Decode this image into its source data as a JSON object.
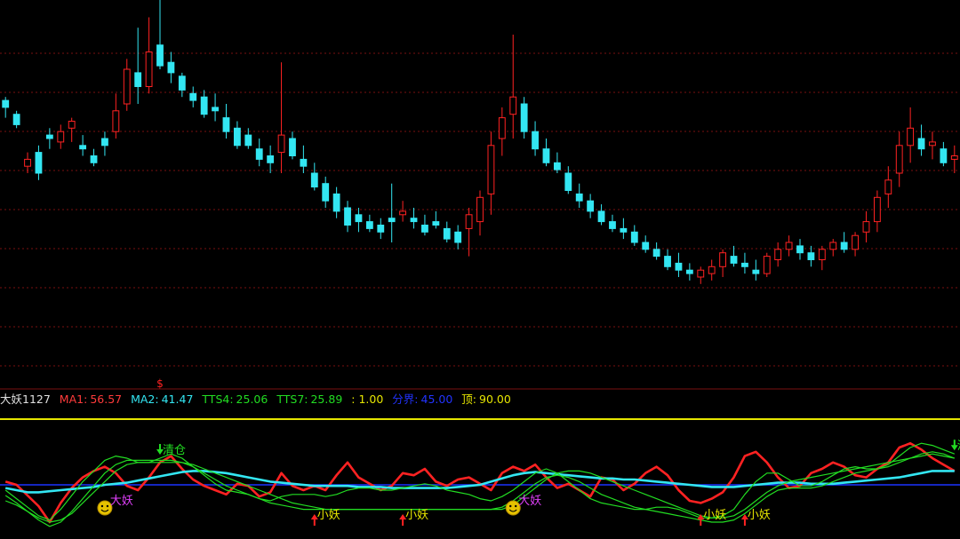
{
  "indicator_name": "大妖1127",
  "legend": [
    {
      "label": "MA1:",
      "value": "56.57",
      "color": "#ff3b3b"
    },
    {
      "label": "MA2:",
      "value": "41.47",
      "color": "#33e6f2"
    },
    {
      "label": "TTS4:",
      "value": "25.06",
      "color": "#22dd22"
    },
    {
      "label": "TTS7:",
      "value": "25.89",
      "color": "#22dd22"
    },
    {
      "label": "",
      "value": ": 1.00",
      "color": "#e6e600"
    },
    {
      "label": "分界:",
      "value": "45.00",
      "color": "#2233ff"
    },
    {
      "label": "顶:",
      "value": "90.00",
      "color": "#e6e600"
    }
  ],
  "colors": {
    "up": "#ff2222",
    "down": "#33e6f2",
    "grid": "#7a1010",
    "separator": "#e6e600",
    "divider_line": "#1a33ff"
  },
  "price_marker": "$",
  "signals": [
    {
      "kind": "big",
      "text": "大妖",
      "icon": "smiley-icon",
      "index": 9
    },
    {
      "kind": "big",
      "text": "大妖",
      "icon": "smiley-icon",
      "index": 46
    },
    {
      "kind": "small",
      "text": "小妖",
      "icon": "up-arrow-icon",
      "index": 28
    },
    {
      "kind": "small",
      "text": "小妖",
      "icon": "up-arrow-icon",
      "index": 36
    },
    {
      "kind": "small",
      "text": "小妖",
      "icon": "up-arrow-icon",
      "index": 63
    },
    {
      "kind": "small",
      "text": "小妖",
      "icon": "up-arrow-icon",
      "index": 67
    },
    {
      "kind": "clear",
      "text": "清仓",
      "icon": "down-arrow-icon",
      "index": 14
    },
    {
      "kind": "clear",
      "text": "清仓",
      "icon": "down-arrow-icon",
      "index": 86
    }
  ],
  "chart_data": [
    {
      "type": "candlestick",
      "ylim": [
        0,
        100
      ],
      "grid": true,
      "candles": [
        [
          71,
          72,
          66,
          69
        ],
        [
          67,
          68,
          63,
          64
        ],
        [
          52,
          56,
          50,
          54
        ],
        [
          56,
          58,
          48,
          50
        ],
        [
          61,
          63,
          57,
          60
        ],
        [
          59,
          64,
          57,
          62
        ],
        [
          63,
          66,
          59,
          65
        ],
        [
          58,
          61,
          55,
          57
        ],
        [
          55,
          57,
          52,
          53
        ],
        [
          60,
          62,
          55,
          58
        ],
        [
          62,
          73,
          60,
          68
        ],
        [
          70,
          83,
          68,
          80
        ],
        [
          79,
          92,
          70,
          75
        ],
        [
          75,
          95,
          73,
          85
        ],
        [
          87,
          100,
          80,
          81
        ],
        [
          82,
          85,
          76,
          79
        ],
        [
          78,
          79,
          72,
          74
        ],
        [
          73,
          75,
          69,
          71
        ],
        [
          72,
          74,
          66,
          67
        ],
        [
          69,
          73,
          65,
          68
        ],
        [
          66,
          70,
          60,
          62
        ],
        [
          63,
          65,
          57,
          58
        ],
        [
          61,
          63,
          57,
          58
        ],
        [
          57,
          60,
          52,
          54
        ],
        [
          55,
          58,
          50,
          53
        ],
        [
          56,
          82,
          50,
          61
        ],
        [
          60,
          62,
          54,
          55
        ],
        [
          54,
          58,
          50,
          52
        ],
        [
          50,
          53,
          45,
          46
        ],
        [
          47,
          49,
          40,
          42
        ],
        [
          44,
          46,
          37,
          39
        ],
        [
          40,
          42,
          33,
          35
        ],
        [
          38,
          40,
          33,
          36
        ],
        [
          36,
          38,
          33,
          34
        ],
        [
          35,
          37,
          31,
          33
        ],
        [
          37,
          47,
          30,
          36
        ],
        [
          38,
          42,
          36,
          39
        ],
        [
          37,
          40,
          34,
          36
        ],
        [
          35,
          38,
          32,
          33
        ],
        [
          36,
          39,
          34,
          35
        ],
        [
          34,
          36,
          30,
          31
        ],
        [
          33,
          35,
          28,
          30
        ],
        [
          34,
          40,
          26,
          38
        ],
        [
          36,
          45,
          32,
          43
        ],
        [
          44,
          62,
          38,
          58
        ],
        [
          60,
          69,
          55,
          66
        ],
        [
          67,
          90,
          60,
          72
        ],
        [
          70,
          72,
          60,
          62
        ],
        [
          62,
          65,
          55,
          57
        ],
        [
          57,
          60,
          52,
          53
        ],
        [
          53,
          56,
          50,
          51
        ],
        [
          50,
          52,
          44,
          45
        ],
        [
          44,
          47,
          40,
          42
        ],
        [
          42,
          44,
          37,
          39
        ],
        [
          39,
          41,
          35,
          36
        ],
        [
          36,
          38,
          33,
          34
        ],
        [
          34,
          37,
          31,
          33
        ],
        [
          33,
          35,
          29,
          30
        ],
        [
          30,
          32,
          27,
          28
        ],
        [
          28,
          30,
          25,
          26
        ],
        [
          26,
          28,
          22,
          23
        ],
        [
          24,
          27,
          20,
          22
        ],
        [
          22,
          24,
          19,
          21
        ],
        [
          20,
          23,
          18,
          22
        ],
        [
          21,
          25,
          19,
          23
        ],
        [
          23,
          28,
          20,
          27
        ],
        [
          26,
          29,
          23,
          24
        ],
        [
          24,
          27,
          21,
          23
        ],
        [
          22,
          25,
          19,
          21
        ],
        [
          21,
          27,
          20,
          26
        ],
        [
          25,
          30,
          23,
          28
        ],
        [
          28,
          32,
          26,
          30
        ],
        [
          29,
          31,
          25,
          27
        ],
        [
          27,
          29,
          23,
          25
        ],
        [
          25,
          29,
          22,
          28
        ],
        [
          28,
          31,
          26,
          30
        ],
        [
          30,
          33,
          27,
          28
        ],
        [
          28,
          33,
          26,
          32
        ],
        [
          33,
          39,
          30,
          36
        ],
        [
          36,
          45,
          33,
          43
        ],
        [
          44,
          52,
          40,
          48
        ],
        [
          50,
          62,
          46,
          58
        ],
        [
          58,
          69,
          53,
          63
        ],
        [
          60,
          64,
          55,
          57
        ],
        [
          58,
          62,
          54,
          59
        ],
        [
          57,
          59,
          52,
          53
        ],
        [
          54,
          58,
          50,
          55
        ]
      ]
    },
    {
      "type": "line",
      "ylim": [
        0,
        100
      ],
      "reference_lines": [
        {
          "name": "分界",
          "value": 45
        },
        {
          "name": "顶",
          "value": 90
        }
      ],
      "series": [
        {
          "name": "MA1",
          "color": "#ff2222",
          "width": 2.6,
          "values": [
            48,
            45,
            35,
            25,
            10,
            28,
            42,
            52,
            58,
            62,
            56,
            44,
            40,
            52,
            66,
            72,
            60,
            50,
            44,
            40,
            36,
            46,
            44,
            34,
            38,
            56,
            44,
            40,
            44,
            40,
            54,
            66,
            52,
            46,
            40,
            44,
            56,
            54,
            60,
            48,
            44,
            50,
            52,
            46,
            40,
            56,
            62,
            58,
            64,
            52,
            42,
            46,
            40,
            34,
            52,
            50,
            40,
            46,
            56,
            62,
            54,
            40,
            30,
            28,
            32,
            38,
            52,
            72,
            76,
            66,
            52,
            42,
            44,
            56,
            60,
            66,
            62,
            54,
            52,
            60,
            66,
            80,
            84,
            78,
            70,
            64,
            58
          ]
        },
        {
          "name": "MA2",
          "color": "#33e6f2",
          "width": 2.6,
          "values": [
            42,
            40,
            38,
            38,
            39,
            40,
            41,
            42,
            43,
            45,
            46,
            47,
            49,
            51,
            53,
            55,
            57,
            58,
            58,
            57,
            56,
            54,
            52,
            50,
            48,
            47,
            46,
            45,
            44,
            44,
            44,
            44,
            43,
            43,
            43,
            42,
            42,
            42,
            42,
            42,
            42,
            43,
            44,
            45,
            48,
            51,
            54,
            56,
            57,
            56,
            55,
            54,
            53,
            52,
            51,
            51,
            50,
            50,
            49,
            48,
            47,
            46,
            45,
            44,
            43,
            43,
            43,
            44,
            45,
            46,
            47,
            47,
            47,
            46,
            46,
            46,
            47,
            48,
            49,
            50,
            51,
            52,
            54,
            56,
            58,
            58,
            58
          ]
        },
        {
          "name": "TTS4",
          "color": "#22dd22",
          "width": 1.2,
          "values": [
            40,
            32,
            24,
            16,
            12,
            22,
            35,
            48,
            58,
            68,
            72,
            70,
            66,
            66,
            70,
            74,
            70,
            62,
            54,
            46,
            40,
            38,
            36,
            32,
            30,
            34,
            36,
            36,
            36,
            34,
            36,
            40,
            42,
            42,
            40,
            40,
            42,
            44,
            46,
            44,
            40,
            38,
            36,
            32,
            30,
            34,
            40,
            48,
            56,
            60,
            56,
            48,
            40,
            32,
            28,
            26,
            24,
            22,
            22,
            24,
            24,
            22,
            18,
            14,
            14,
            16,
            22,
            36,
            48,
            56,
            56,
            50,
            44,
            44,
            48,
            54,
            60,
            62,
            60,
            60,
            64,
            72,
            80,
            84,
            82,
            78,
            74
          ]
        },
        {
          "name": "TTS7",
          "color": "#22dd22",
          "width": 1.2,
          "values": [
            35,
            28,
            20,
            12,
            6,
            10,
            20,
            32,
            44,
            56,
            64,
            68,
            68,
            68,
            68,
            68,
            66,
            62,
            56,
            50,
            44,
            40,
            36,
            32,
            28,
            26,
            24,
            22,
            22,
            22,
            22,
            22,
            22,
            22,
            22,
            22,
            22,
            22,
            22,
            22,
            22,
            22,
            22,
            22,
            22,
            24,
            30,
            38,
            46,
            52,
            54,
            52,
            48,
            42,
            36,
            32,
            28,
            24,
            22,
            20,
            18,
            16,
            14,
            12,
            10,
            10,
            12,
            18,
            26,
            34,
            40,
            42,
            42,
            42,
            44,
            48,
            52,
            56,
            58,
            60,
            62,
            66,
            70,
            74,
            76,
            74,
            70
          ]
        },
        {
          "name": "TTS7",
          "color": "#22dd22",
          "width": 1.2,
          "values": [
            30,
            26,
            20,
            14,
            10,
            12,
            18,
            28,
            38,
            48,
            58,
            64,
            66,
            66,
            66,
            66,
            66,
            64,
            60,
            56,
            52,
            48,
            44,
            40,
            36,
            32,
            28,
            26,
            24,
            22,
            22,
            22,
            22,
            22,
            22,
            22,
            22,
            22,
            22,
            22,
            22,
            22,
            22,
            22,
            22,
            22,
            26,
            34,
            42,
            50,
            56,
            58,
            58,
            56,
            52,
            48,
            44,
            40,
            36,
            32,
            28,
            24,
            20,
            16,
            14,
            14,
            16,
            22,
            30,
            38,
            44,
            48,
            50,
            52,
            54,
            56,
            58,
            60,
            62,
            64,
            66,
            68,
            70,
            72,
            74,
            72,
            70
          ]
        }
      ]
    }
  ]
}
